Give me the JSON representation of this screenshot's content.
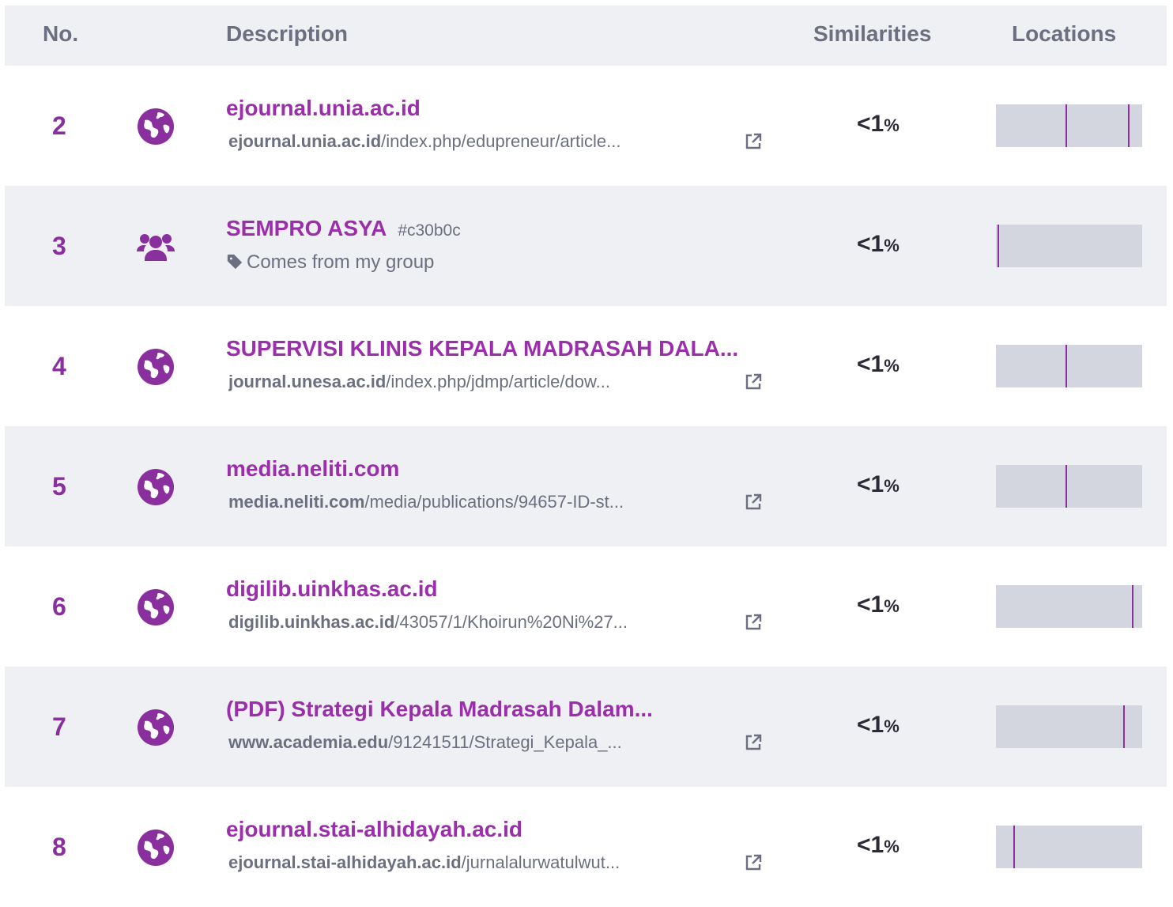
{
  "header": {
    "no": "No.",
    "description": "Description",
    "similarities": "Similarities",
    "locations": "Locations"
  },
  "colors": {
    "accent": "#9b2eab",
    "number": "#8a2f9e",
    "header_bg": "#eff0f3",
    "bar": "#d3d6de"
  },
  "rows": [
    {
      "no": "2",
      "icon": "globe-icon",
      "title": "ejournal.unia.ac.id",
      "url_domain": "ejournal.unia.ac.id",
      "url_path": "/index.php/edupreneur/article...",
      "similarity_value": "<1",
      "similarity_unit": "%",
      "location_marks": [
        0.48,
        0.91
      ]
    },
    {
      "no": "3",
      "icon": "group-icon",
      "title": "SEMPRO ASYA",
      "tag": "#c30b0c",
      "subtitle": "Comes from my group",
      "similarity_value": "<1",
      "similarity_unit": "%",
      "location_marks": [
        0.01
      ]
    },
    {
      "no": "4",
      "icon": "globe-icon",
      "title": "SUPERVISI KLINIS KEPALA MADRASAH DALA...",
      "url_domain": "journal.unesa.ac.id",
      "url_path": "/index.php/jdmp/article/dow...",
      "similarity_value": "<1",
      "similarity_unit": "%",
      "location_marks": [
        0.48
      ]
    },
    {
      "no": "5",
      "icon": "globe-icon",
      "title": "media.neliti.com",
      "url_domain": "media.neliti.com",
      "url_path": "/media/publications/94657-ID-st...",
      "similarity_value": "<1",
      "similarity_unit": "%",
      "location_marks": [
        0.48
      ]
    },
    {
      "no": "6",
      "icon": "globe-icon",
      "title": "digilib.uinkhas.ac.id",
      "url_domain": "digilib.uinkhas.ac.id",
      "url_path": "/43057/1/Khoirun%20Ni%27...",
      "similarity_value": "<1",
      "similarity_unit": "%",
      "location_marks": [
        0.94
      ]
    },
    {
      "no": "7",
      "icon": "globe-icon",
      "title": "(PDF) Strategi Kepala Madrasah Dalam...",
      "url_domain": "www.academia.edu",
      "url_path": "/91241511/Strategi_Kepala_...",
      "similarity_value": "<1",
      "similarity_unit": "%",
      "location_marks": [
        0.88
      ]
    },
    {
      "no": "8",
      "icon": "globe-icon",
      "title": "ejournal.stai-alhidayah.ac.id",
      "url_domain": "ejournal.stai-alhidayah.ac.id",
      "url_path": "/jurnalalurwatulwut...",
      "similarity_value": "<1",
      "similarity_unit": "%",
      "location_marks": [
        0.12
      ]
    }
  ]
}
